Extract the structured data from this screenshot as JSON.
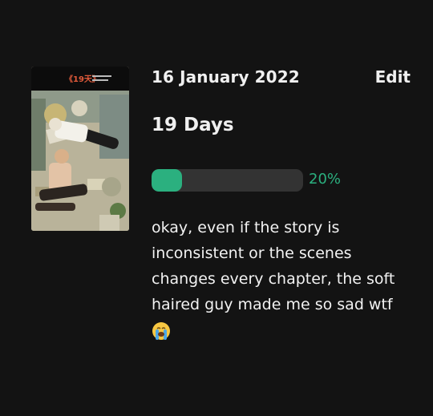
{
  "entry": {
    "date": "16 January 2022",
    "edit_label": "Edit",
    "title": "19 Days",
    "progress_percent": 20,
    "progress_label": "20%",
    "review_text": "okay, even if the story is inconsistent or the scenes changes every chapter, the soft haired guy made me so sad wtf",
    "review_emoji": "loudly-crying-face-icon"
  },
  "cover": {
    "logo_text": "《19天》"
  },
  "colors": {
    "background": "#131313",
    "accent": "#2bb07f",
    "track": "#333333",
    "text": "#f0f0f0"
  }
}
